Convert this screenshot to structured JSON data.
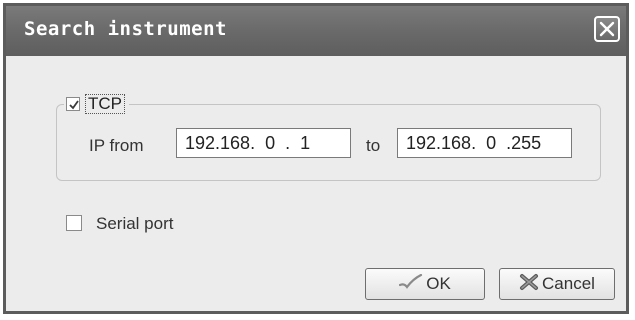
{
  "dialog": {
    "title": "Search instrument",
    "close_icon": "close-icon"
  },
  "tcp": {
    "label": "TCP",
    "checked": true,
    "ip_from_label": "IP from",
    "ip_from_value": "192.168.  0  .  1",
    "to_label": "to",
    "ip_to_value": "192.168.  0  .255"
  },
  "serial": {
    "label": "Serial port",
    "checked": false
  },
  "buttons": {
    "ok_label": "OK",
    "ok_icon": "checkmark-icon",
    "cancel_label": "Cancel",
    "cancel_icon": "cancel-x-icon"
  }
}
